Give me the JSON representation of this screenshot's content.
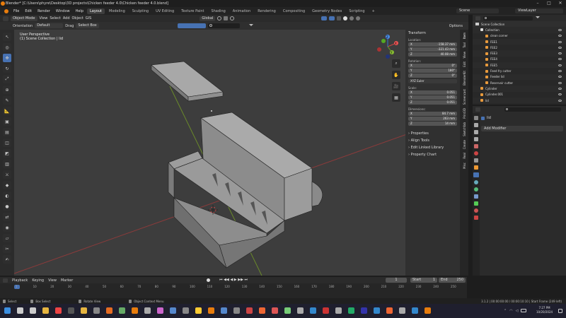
{
  "title": "Blender* [C:\\Users\\phyre\\Desktop\\3D projects\\Chicken feeder 4.0\\Chicken feeder 4.0.blend]",
  "window_controls": [
    "–",
    "□",
    "✕"
  ],
  "menus": [
    "File",
    "Edit",
    "Render",
    "Window",
    "Help"
  ],
  "workspaces": [
    "Layout",
    "Modeling",
    "Sculpting",
    "UV Editing",
    "Texture Paint",
    "Shading",
    "Animation",
    "Rendering",
    "Compositing",
    "Geometry Nodes",
    "Scripting"
  ],
  "workspace_plus": "+",
  "scene_label": "Scene",
  "viewlayer_label": "ViewLayer",
  "viewport_header": {
    "mode": "Object Mode",
    "menus": [
      "View",
      "Select",
      "Add",
      "Object",
      "GIS"
    ],
    "transform_orientation": "Global",
    "orientation_label": "Orientation",
    "orientation_value": "Default",
    "drag_label": "Drag",
    "drag_value": "Select Box",
    "options": "Options"
  },
  "viewport": {
    "info1": "User Perspective",
    "info2": "(1) Scene Collection | lid"
  },
  "gizmo": {
    "x": "X",
    "y": "Y",
    "z": "Z"
  },
  "npanel": {
    "transform": "Transform",
    "location_label": "Location:",
    "location": [
      {
        "axis": "X",
        "value": "-158.37 mm"
      },
      {
        "axis": "Y",
        "value": "-321.43 mm"
      },
      {
        "axis": "Z",
        "value": "40.08 mm"
      }
    ],
    "rotation_label": "Rotation:",
    "rotation": [
      {
        "axis": "X",
        "value": "0°"
      },
      {
        "axis": "Y",
        "value": "180°"
      },
      {
        "axis": "Z",
        "value": "0°"
      }
    ],
    "rotation_mode": "XYZ Euler",
    "scale_label": "Scale:",
    "scale": [
      {
        "axis": "X",
        "value": "0.051"
      },
      {
        "axis": "Y",
        "value": "0.051"
      },
      {
        "axis": "Z",
        "value": "0.051"
      }
    ],
    "dimensions_label": "Dimensions:",
    "dimensions": [
      {
        "axis": "X",
        "value": "84.7 mm"
      },
      {
        "axis": "Y",
        "value": "263 mm"
      },
      {
        "axis": "Z",
        "value": "14 mm"
      }
    ],
    "sections": [
      "Properties",
      "Align Tools",
      "Edit Linked Library",
      "Property Chart"
    ]
  },
  "ntabs": [
    "Item",
    "Tool",
    "View",
    "Edit",
    "BlenderKit",
    "Screencast",
    "Print3D",
    "Sketchfab",
    "Create",
    "Real",
    "Misc"
  ],
  "outliner": {
    "root": "Scene Collection",
    "rows": [
      {
        "name": "Collection",
        "depth": 1
      },
      {
        "name": "clean corner",
        "depth": 2
      },
      {
        "name": "FEE1",
        "depth": 2
      },
      {
        "name": "FEE2",
        "depth": 2
      },
      {
        "name": "FEE3",
        "depth": 2
      },
      {
        "name": "FEE4",
        "depth": 2
      },
      {
        "name": "FEE5",
        "depth": 2
      },
      {
        "name": "Feed fry cutter",
        "depth": 2
      },
      {
        "name": "Feeder lid",
        "depth": 2
      },
      {
        "name": "Reservoir cutter",
        "depth": 2
      },
      {
        "name": "Cylinder",
        "depth": 1
      },
      {
        "name": "Cylinder.001",
        "depth": 1
      },
      {
        "name": "lid",
        "depth": 1
      }
    ]
  },
  "properties": {
    "object": "lid",
    "add_modifier": "Add Modifier"
  },
  "timeline": {
    "menus": [
      "Playback",
      "Keying",
      "View",
      "Marker"
    ],
    "current_frame": "1",
    "start_label": "Start",
    "start": "1",
    "end_label": "End",
    "end": "250",
    "ticks": [
      "1",
      "10",
      "20",
      "30",
      "40",
      "50",
      "60",
      "70",
      "80",
      "90",
      "100",
      "110",
      "120",
      "130",
      "140",
      "150",
      "160",
      "170",
      "180",
      "190",
      "200",
      "210",
      "220",
      "230",
      "240",
      "250"
    ]
  },
  "status": {
    "select": "Select",
    "box_select": "Box Select",
    "rotate": "Rotate View",
    "context": "Object Context Menu",
    "info": "3.1.2 | 00:00:00:00 / 00:00:10:10 | Start Frame (249 left)"
  },
  "taskbar": {
    "time": "7:27 PM",
    "date": "10/20/2024"
  },
  "colors": {
    "accent": "#4772b3",
    "viewport_bg": "#3d3d3d",
    "axis_red": "#b04040",
    "axis_green": "#6a8a2a"
  }
}
